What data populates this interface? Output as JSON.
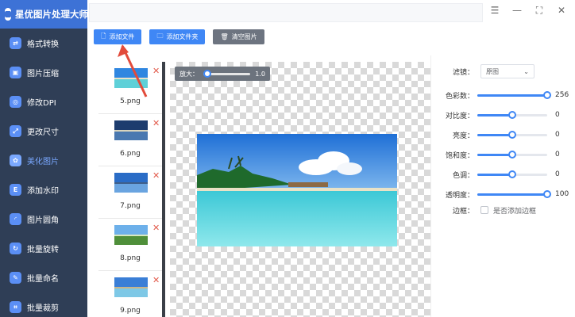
{
  "app": {
    "title": "星优图片处理大师"
  },
  "sidebar": {
    "items": [
      {
        "label": "格式转换",
        "icon": "format-convert-icon",
        "glyph": "⇄"
      },
      {
        "label": "图片压缩",
        "icon": "compress-icon",
        "glyph": "▣"
      },
      {
        "label": "修改DPI",
        "icon": "dpi-icon",
        "glyph": "◎"
      },
      {
        "label": "更改尺寸",
        "icon": "resize-icon",
        "glyph": "⤢"
      },
      {
        "label": "美化图片",
        "icon": "beautify-icon",
        "glyph": "✿"
      },
      {
        "label": "添加水印",
        "icon": "watermark-icon",
        "glyph": "E"
      },
      {
        "label": "图片圆角",
        "icon": "round-corner-icon",
        "glyph": "◜"
      },
      {
        "label": "批量旋转",
        "icon": "rotate-icon",
        "glyph": "↻"
      },
      {
        "label": "批量命名",
        "icon": "rename-icon",
        "glyph": "✎"
      },
      {
        "label": "批量裁剪",
        "icon": "crop-icon",
        "glyph": "⌗"
      }
    ],
    "active_index": 4
  },
  "window_controls": {
    "settings_glyph": "☰",
    "minimize_glyph": "—",
    "maximize_glyph": "⛶",
    "close_glyph": "✕"
  },
  "toolbar": {
    "add_file": "添加文件",
    "add_folder": "添加文件夹",
    "clear_images": "清空图片",
    "add_file_icon": "🗋",
    "add_folder_icon": "🗀",
    "clear_icon": "🗑"
  },
  "files": [
    {
      "name": "5.png",
      "delete_glyph": "✕"
    },
    {
      "name": "6.png",
      "delete_glyph": "✕"
    },
    {
      "name": "7.png",
      "delete_glyph": "✕"
    },
    {
      "name": "8.png",
      "delete_glyph": "✕"
    },
    {
      "name": "9.png",
      "delete_glyph": "✕"
    }
  ],
  "preview": {
    "zoom_label": "放大：",
    "zoom_value": "1.0",
    "zoom_fraction": 0.0
  },
  "settings": {
    "filter_label": "滤镜：",
    "filter_value": "原图",
    "filter_arrow": "⌄",
    "sliders": [
      {
        "label": "色彩数：",
        "value": "256",
        "fraction": 1.0
      },
      {
        "label": "对比度：",
        "value": "0",
        "fraction": 0.5
      },
      {
        "label": "亮度：",
        "value": "0",
        "fraction": 0.5
      },
      {
        "label": "饱和度：",
        "value": "0",
        "fraction": 0.5
      },
      {
        "label": "色调：",
        "value": "0",
        "fraction": 0.5
      },
      {
        "label": "透明度：",
        "value": "100",
        "fraction": 1.0
      }
    ],
    "border_label": "边框：",
    "border_text": "是否添加边框"
  },
  "colors": {
    "accent": "#3f87f5",
    "sidebar_bg": "#2f3e56",
    "header_bg": "#3d72d6",
    "delete_red": "#e25a4b"
  }
}
